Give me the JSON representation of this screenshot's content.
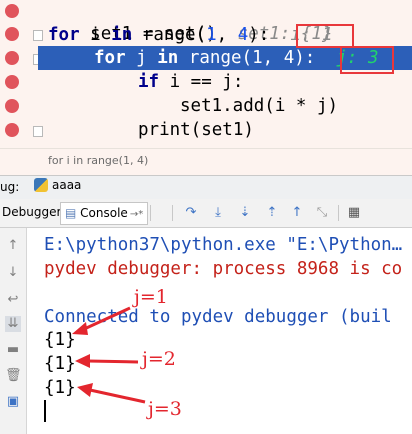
{
  "editor": {
    "lines": [
      {
        "code_a": "set1 = set()",
        "inline": "set1: {1}"
      },
      {
        "kw": "for",
        "code_a": " i ",
        "kw2": "in",
        "code_b": " range(",
        "n1": "1",
        "code_c": ", ",
        "n2": "4",
        "code_d": "):",
        "inline": "i: 1"
      },
      {
        "kw": "for",
        "code_a": " j ",
        "kw2": "in",
        "code_b": " range(",
        "n1": "1",
        "code_c": ", ",
        "n2": "4",
        "code_d": "):",
        "inline": "j: 3"
      },
      {
        "kw": "if",
        "code_a": " i == j:"
      },
      {
        "code_a": "set1.add(i * j)"
      },
      {
        "code_a": "print(set1)"
      }
    ],
    "breadcrumb": "for i in range(1, 4)"
  },
  "debug": {
    "panel_label": "ug:",
    "run_tab": "aaaa",
    "tabs": {
      "debugger": "Debugger",
      "console": "Console",
      "console_suffix": "→*"
    }
  },
  "console": {
    "lines": [
      {
        "text": "E:\\python37\\python.exe \"E:\\Python…",
        "style": "norm"
      },
      {
        "text": "pydev debugger: process 8968 is co",
        "style": "err"
      },
      {
        "text": "",
        "style": "norm"
      },
      {
        "text": "Connected to pydev debugger (buil",
        "style": "norm"
      },
      {
        "text": "{1}",
        "style": "out"
      },
      {
        "text": "{1}",
        "style": "out"
      },
      {
        "text": "{1}",
        "style": "out"
      }
    ]
  },
  "annotations": {
    "a1": "j=1",
    "a2": "j=2",
    "a3": "j=3",
    "color": "#e3262e"
  },
  "icons": [
    "breakpoint-icon",
    "fold-icon",
    "python-icon",
    "console-icon",
    "step-over-icon",
    "step-into-icon",
    "step-into-my-code-icon",
    "step-out-icon",
    "run-to-cursor-icon",
    "evaluate-icon",
    "grid-icon",
    "rerun-icon",
    "stop-icon",
    "soft-wrap-icon",
    "scroll-to-end-icon",
    "print-icon",
    "trash-icon",
    "console-side-icon"
  ]
}
